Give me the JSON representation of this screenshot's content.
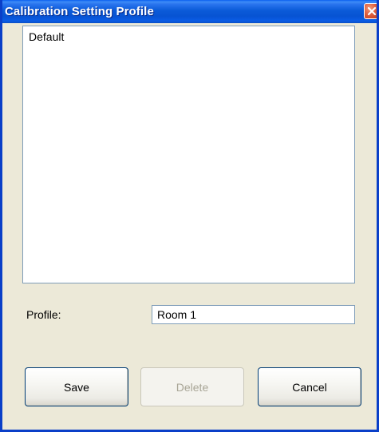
{
  "window": {
    "title": "Calibration Setting Profile"
  },
  "title_bar": {
    "close_icon": "close-x-icon"
  },
  "profile_list": {
    "items": [
      {
        "label": "Default"
      }
    ]
  },
  "profile_field": {
    "label": "Profile:",
    "value": "Room 1"
  },
  "buttons": {
    "save_label": "Save",
    "delete_label": "Delete",
    "cancel_label": "Cancel",
    "delete_enabled": false
  },
  "colors": {
    "title_bar": "#0b5bd8",
    "frame_border": "#0a3fc8",
    "dialog_background": "#ece9d8",
    "close_button": "#e0603e",
    "field_border": "#7f9db9",
    "disabled_text": "#a8a596"
  }
}
